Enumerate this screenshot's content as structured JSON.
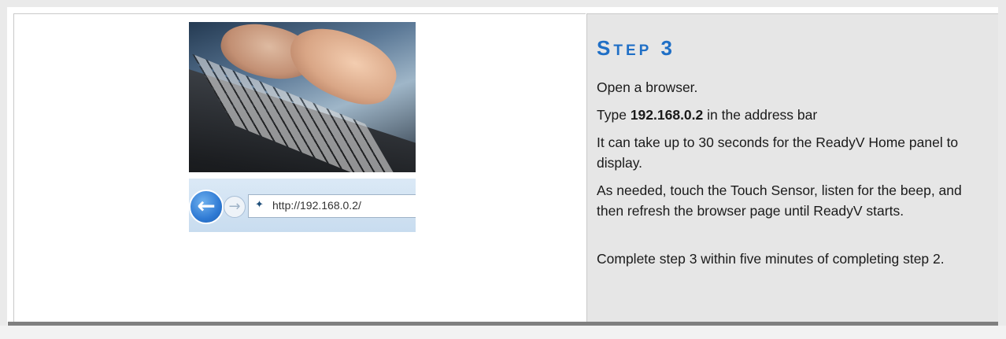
{
  "step": {
    "heading_first": "S",
    "heading_rest": "TEP",
    "heading_number": "3",
    "paragraphs": {
      "p1": "Open a browser.",
      "p2_prefix": "Type ",
      "p2_bold": "192.168.0.2",
      "p2_suffix": " in the address bar",
      "p3": "It can take up to 30 seconds for the ReadyV Home panel to display.",
      "p4": "As needed, touch the Touch Sensor, listen for the beep, and then refresh the browser page until ReadyV starts.",
      "p5": "Complete step 3 within five minutes of completing step 2."
    },
    "heading_color": "#1f6fc6"
  },
  "browser": {
    "url": "http://192.168.0.2/",
    "back_icon": "back-arrow-icon",
    "forward_icon": "forward-arrow-icon",
    "site_icon": "site-favicon-icon"
  },
  "photo": {
    "subject": "hands typing on laptop keyboard"
  }
}
